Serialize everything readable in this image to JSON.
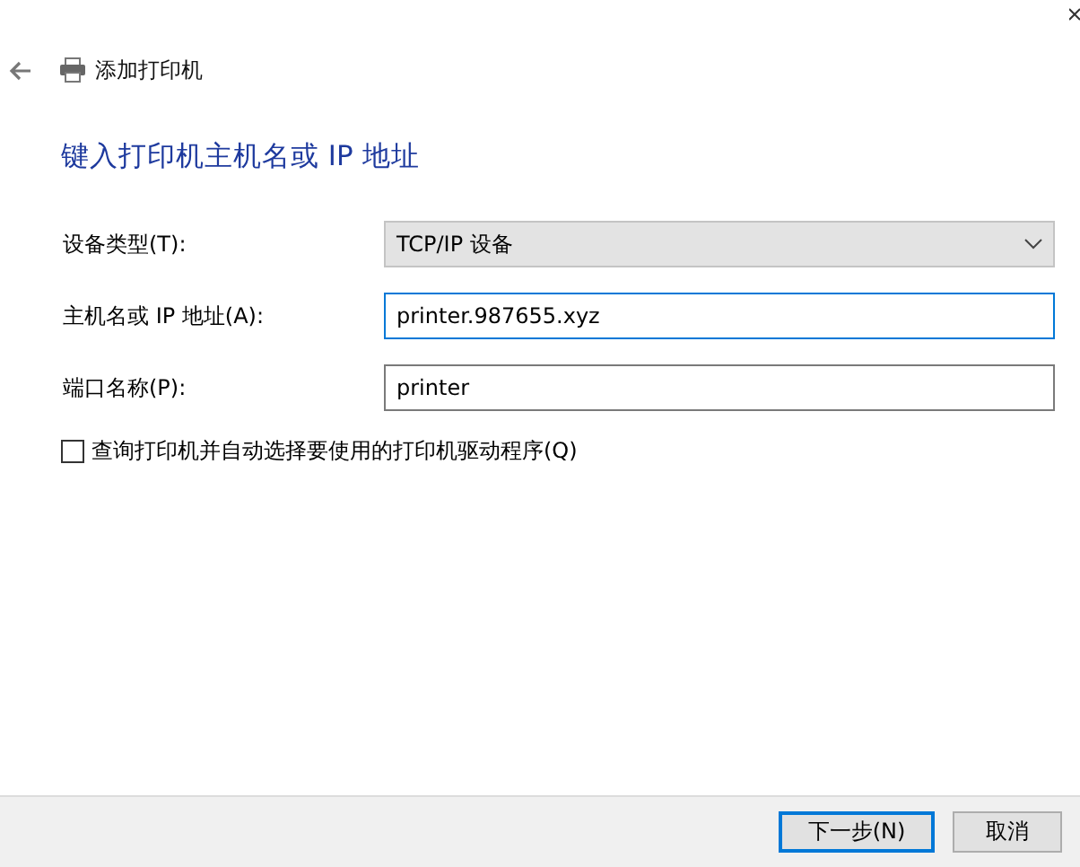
{
  "header": {
    "title": "添加打印机"
  },
  "heading": "键入打印机主机名或 IP 地址",
  "fields": [
    {
      "kind": "dropdown",
      "label": "设备类型(T):",
      "value": "TCP/IP 设备",
      "focused": false
    },
    {
      "kind": "text",
      "label": "主机名或 IP 地址(A):",
      "value": "printer.987655.xyz",
      "focused": true
    },
    {
      "kind": "text",
      "label": "端口名称(P):",
      "value": "printer",
      "focused": false
    }
  ],
  "query_checkbox": {
    "label": "查询打印机并自动选择要使用的打印机驱动程序(Q)",
    "checked": false
  },
  "buttons": [
    {
      "label": "下一步(N)",
      "default": true
    },
    {
      "label": "取消",
      "default": false
    }
  ]
}
